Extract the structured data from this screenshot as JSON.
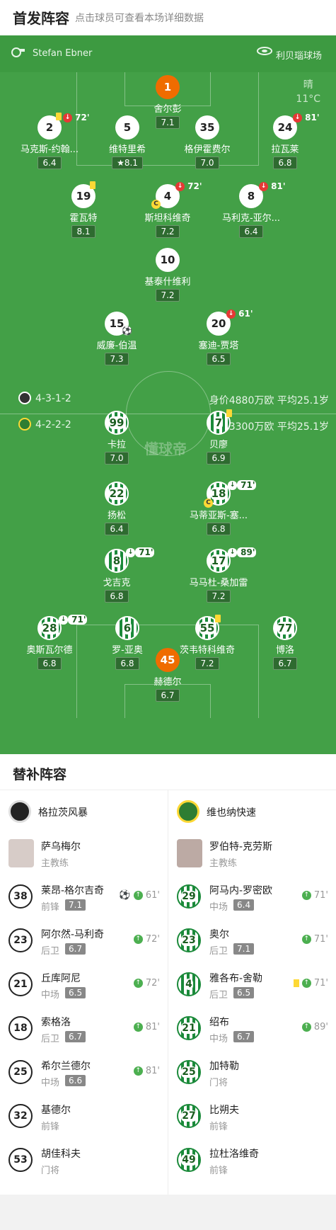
{
  "header": {
    "title": "首发阵容",
    "subtitle": "点击球员可查看本场详细数据"
  },
  "match": {
    "referee": "Stefan Ebner",
    "stadium": "利贝瑙球场",
    "weather": "晴",
    "temp": "11°C",
    "watermark": "懂球帝"
  },
  "home_form": {
    "formation": "4-3-1-2",
    "value": "身价4880万欧 平均25.1岁"
  },
  "away_form": {
    "formation": "4-2-2-2",
    "value": "身价3300万欧 平均25.1岁"
  },
  "home": [
    {
      "num": "1",
      "name": "舍尔彭",
      "rating": "7.1",
      "gk": true
    },
    {
      "num": "2",
      "name": "马克斯-约翰...",
      "rating": "6.4",
      "sub": "72'",
      "ycard": true
    },
    {
      "num": "5",
      "name": "维特里希",
      "rating": "8.1",
      "star": true
    },
    {
      "num": "35",
      "name": "格伊霍费尔",
      "rating": "7.0"
    },
    {
      "num": "24",
      "name": "拉瓦莱",
      "rating": "6.8",
      "sub": "81'"
    },
    {
      "num": "19",
      "name": "霍瓦特",
      "rating": "8.1",
      "ycard": true
    },
    {
      "num": "4",
      "name": "斯坦科维奇",
      "rating": "7.2",
      "sub": "72'",
      "capt": true
    },
    {
      "num": "8",
      "name": "马利克-亚尔...",
      "rating": "6.4",
      "sub": "81'"
    },
    {
      "num": "10",
      "name": "基泰什维利",
      "rating": "7.2"
    },
    {
      "num": "15",
      "name": "威廉-伯温",
      "rating": "7.3",
      "goal": true
    },
    {
      "num": "20",
      "name": "塞迪-贾塔",
      "rating": "6.5",
      "sub": "61'"
    }
  ],
  "away": [
    {
      "num": "99",
      "name": "卡拉",
      "rating": "7.0"
    },
    {
      "num": "7",
      "name": "贝廖",
      "rating": "6.9",
      "ycard": true
    },
    {
      "num": "22",
      "name": "扬松",
      "rating": "6.4"
    },
    {
      "num": "18",
      "name": "马蒂亚斯-塞...",
      "rating": "6.8",
      "sub": "71'",
      "capt": true
    },
    {
      "num": "8",
      "name": "戈吉克",
      "rating": "6.8",
      "sub": "71'"
    },
    {
      "num": "17",
      "name": "马马杜-桑加雷",
      "rating": "7.2",
      "sub": "89'"
    },
    {
      "num": "28",
      "name": "奥斯瓦尔德",
      "rating": "6.8",
      "sub": "71'"
    },
    {
      "num": "6",
      "name": "罗-亚奥",
      "rating": "6.8"
    },
    {
      "num": "55",
      "name": "茨韦特科维奇",
      "rating": "7.2",
      "ycard": true
    },
    {
      "num": "77",
      "name": "博洛",
      "rating": "6.7"
    },
    {
      "num": "45",
      "name": "赫德尔",
      "rating": "6.7",
      "gk": true
    }
  ],
  "subs": {
    "title": "替补阵容",
    "home_team": "格拉茨风暴",
    "away_team": "维也纳快速",
    "home_coach": {
      "name": "萨乌梅尔",
      "role": "主教练"
    },
    "away_coach": {
      "name": "罗伯特-克劳斯",
      "role": "主教练"
    },
    "home_list": [
      {
        "num": "38",
        "name": "莱昂-格尔吉奇",
        "pos": "前锋",
        "rating": "7.1",
        "ev": "61'",
        "goal": true
      },
      {
        "num": "23",
        "name": "阿尔然-马利奇",
        "pos": "后卫",
        "rating": "6.7",
        "ev": "72'"
      },
      {
        "num": "21",
        "name": "丘库阿尼",
        "pos": "中场",
        "rating": "6.5",
        "ev": "72'"
      },
      {
        "num": "18",
        "name": "索格洛",
        "pos": "后卫",
        "rating": "6.7",
        "ev": "81'"
      },
      {
        "num": "25",
        "name": "希尔兰德尔",
        "pos": "中场",
        "rating": "6.6",
        "ev": "81'"
      },
      {
        "num": "32",
        "name": "基德尔",
        "pos": "前锋",
        "rating": "",
        "ev": ""
      },
      {
        "num": "53",
        "name": "胡佳科夫",
        "pos": "门将",
        "rating": "",
        "ev": ""
      }
    ],
    "away_list": [
      {
        "num": "29",
        "name": "阿马内-罗密欧",
        "pos": "中场",
        "rating": "6.4",
        "ev": "71'"
      },
      {
        "num": "23",
        "name": "奥尔",
        "pos": "后卫",
        "rating": "7.1",
        "ev": "71'"
      },
      {
        "num": "4",
        "name": "雅各布-舍勒",
        "pos": "后卫",
        "rating": "6.5",
        "ev": "71'",
        "ycard": true
      },
      {
        "num": "21",
        "name": "绍布",
        "pos": "中场",
        "rating": "6.7",
        "ev": "89'"
      },
      {
        "num": "25",
        "name": "加特勒",
        "pos": "门将",
        "rating": "",
        "ev": ""
      },
      {
        "num": "27",
        "name": "比朔夫",
        "pos": "前锋",
        "rating": "",
        "ev": ""
      },
      {
        "num": "49",
        "name": "拉杜洛维奇",
        "pos": "前锋",
        "rating": "",
        "ev": ""
      }
    ]
  }
}
